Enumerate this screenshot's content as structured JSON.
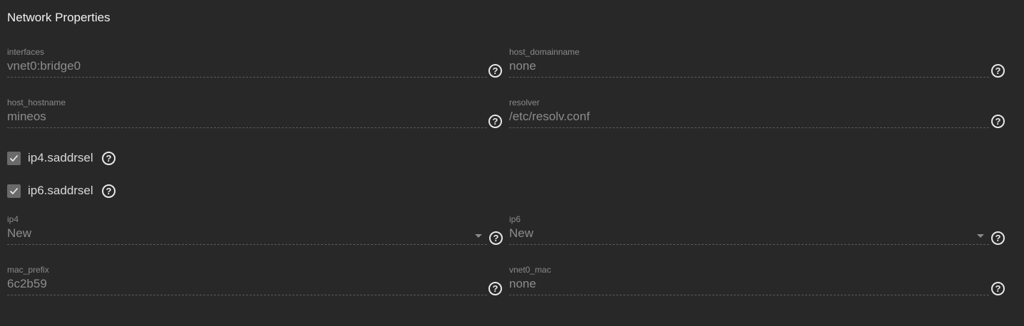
{
  "section": {
    "title": "Network Properties"
  },
  "fields": {
    "interfaces": {
      "label": "interfaces",
      "value": "vnet0:bridge0"
    },
    "host_domainname": {
      "label": "host_domainname",
      "value": "none"
    },
    "host_hostname": {
      "label": "host_hostname",
      "value": "mineos"
    },
    "resolver": {
      "label": "resolver",
      "value": "/etc/resolv.conf"
    },
    "ip4": {
      "label": "ip4",
      "value": "New"
    },
    "ip6": {
      "label": "ip6",
      "value": "New"
    },
    "mac_prefix": {
      "label": "mac_prefix",
      "value": "6c2b59"
    },
    "vnet0_mac": {
      "label": "vnet0_mac",
      "value": "none"
    }
  },
  "checkboxes": {
    "ip4_saddrsel": {
      "label": "ip4.saddrsel",
      "checked": true
    },
    "ip6_saddrsel": {
      "label": "ip6.saddrsel",
      "checked": true
    }
  },
  "icons": {
    "help": "help-circle-icon",
    "check": "check-icon",
    "dropdown": "caret-down-icon"
  },
  "colors": {
    "background": "#282828",
    "title": "#f2f2f2",
    "label": "#8a8a8a",
    "value": "#8c8c8c",
    "checkbox": "#6a6a6a"
  },
  "help_glyph": "?"
}
